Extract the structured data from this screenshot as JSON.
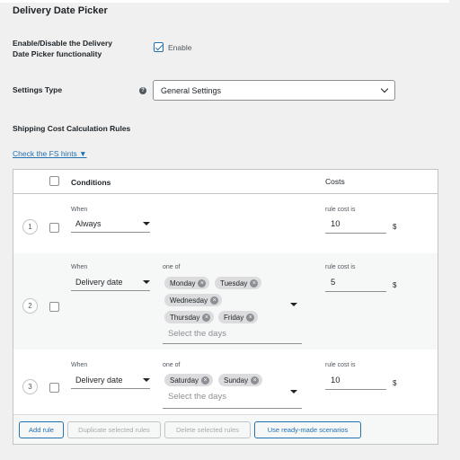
{
  "page": {
    "title": "Delivery Date Picker"
  },
  "enable_setting": {
    "label_line1": "Enable/Disable the Delivery",
    "label_line2": "Date Picker functionality",
    "checkbox_label": "Enable",
    "checked": true
  },
  "settings_type": {
    "label": "Settings Type",
    "selected": "General Settings"
  },
  "shipping_rules": {
    "heading": "Shipping Cost Calculation Rules",
    "hints_link": "Check the FS hints ▼"
  },
  "table": {
    "header_conditions": "Conditions",
    "header_costs": "Costs",
    "when_label": "When",
    "one_of_label": "one of",
    "rule_cost_label": "rule cost is",
    "currency": "$",
    "select_days_placeholder": "Select the days",
    "rows": [
      {
        "number": "1",
        "when": "Always",
        "cost": "10",
        "days": []
      },
      {
        "number": "2",
        "when": "Delivery date",
        "cost": "5",
        "days": [
          "Monday",
          "Tuesday",
          "Wednesday",
          "Thursday",
          "Friday"
        ]
      },
      {
        "number": "3",
        "when": "Delivery date",
        "cost": "10",
        "days": [
          "Saturday",
          "Sunday"
        ]
      }
    ]
  },
  "buttons": {
    "add_rule": "Add rule",
    "duplicate": "Duplicate selected rules",
    "delete": "Delete selected rules",
    "scenarios": "Use ready-made scenarios"
  },
  "icons": {
    "help": "?",
    "chip_remove": "×"
  }
}
